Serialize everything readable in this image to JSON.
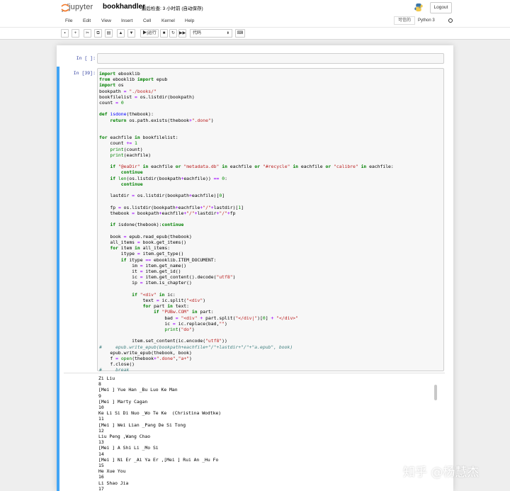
{
  "header": {
    "logo_text": "jupyter",
    "notebook_name": "bookhandler",
    "checkpoint": "最后检查: 3 小时前  (自动保存)",
    "logout_label": "Logout"
  },
  "menubar": {
    "items": [
      "File",
      "Edit",
      "View",
      "Insert",
      "Cell",
      "Kernel",
      "Help"
    ],
    "trusted_label": "可信的",
    "kernel_name": "Python 3"
  },
  "toolbar": {
    "run_label": "运行",
    "cell_type": "代码"
  },
  "cells": [
    {
      "prompt": "In [ ]:",
      "code": ""
    },
    {
      "prompt": "In [39]:",
      "code": "import ebooklib\nfrom ebooklib import epub\nimport os\nbookpath = \"./books/\"\nbookfilelist = os.listdir(bookpath)\ncount = 0\n\ndef isdone(thebook):\n    return os.path.exists(thebook+\".done\")\n\n\nfor eachfile in bookfilelist:\n    count += 1\n    print(count)\n    print(eachfile)\n\n    if \"@eaDir\" in eachfile or \"metadata.db\" in eachfile or \"#recycle\" in eachfile or \"calibre\" in eachfile:\n        continue\n    if len(os.listdir(bookpath+eachfile)) == 0:\n        continue\n\n    lastdir = os.listdir(bookpath+eachfile)[0]\n\n    fp = os.listdir(bookpath+eachfile+\"/\"+lastdir)[1]\n    thebook = bookpath+eachfile+\"/\"+lastdir+\"/\"+fp\n\n    if isdone(thebook):continue\n\n    book = epub.read_epub(thebook)\n    all_items = book.get_items()\n    for item in all_items:\n        itype = item.get_type()\n        if itype == ebooklib.ITEM_DOCUMENT:\n            im = item.get_name()\n            it = item.get_id()\n            ic = item.get_content().decode(\"utf8\")\n            ip = item.is_chapter()\n\n            if \"<div\" in ic:\n                text = ic.split(\"<div\")\n                for part in text:\n                    if \"PUBw.COM\" in part:\n                        bad = \"<div\" + part.split(\"</div|\")[0] + \"</div>\"\n                        ic = ic.replace(bad,\"\")\n                        print(\"do\")\n\n            item.set_content(ic.encode(\"utf8\"))\n#     epub.write_epub(bookpath+eachfile+\"/\"+lastdir+\"/\"+\"a.epub\", book)\n    epub.write_epub(thebook, book)\n    f = open(thebook+\".done\",\"a+\")\n    f.close()\n#     break"
    }
  ],
  "output": {
    "text": "Zi Liu\n8\n[Mei ] Yue Han _Bu Luo Ke Man\n9\n[Mei ] Marty Cagan\n10\nKe Li Si Di Nuo _Wo Te Ke  (Christina Wodtke)\n11\n[Mei ] Wei Lian _Pang De Si Tong\n12\nLiu Peng ,Wang Chao\n13\n[Mei ] A Shi Li _Mo Si\n14\n[Mei ] Ni Er _Ai Ya Er ,[Mei ] Rui An _Hu Fo\n15\nHe Xue You\n16\nLi Shao Jia\n17"
  },
  "watermark": "知乎 @杨慧杰",
  "colors": {
    "selected_border": "#42a5f5",
    "prompt": "#303f9f",
    "keyword": "#008000",
    "string": "#ba2121",
    "comment": "#408080"
  }
}
